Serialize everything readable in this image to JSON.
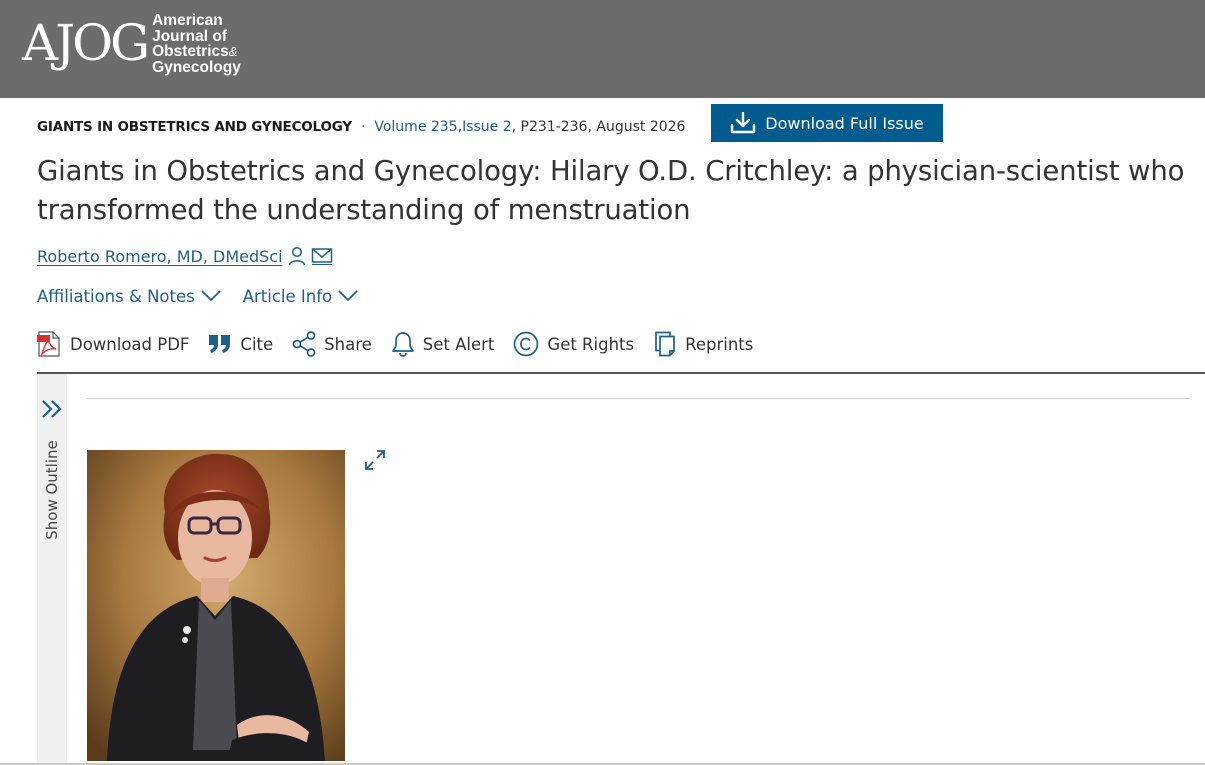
{
  "header": {
    "logo_mark": "AJOG",
    "logo_line1": "American",
    "logo_line2": "Journal of",
    "logo_line3": "Obstetrics",
    "logo_amp": "&",
    "logo_line4": "Gynecology"
  },
  "meta": {
    "section": "GIANTS IN OBSTETRICS AND GYNECOLOGY",
    "separator": "·",
    "volume": "Volume 235",
    "comma1": ", ",
    "issue": "Issue 2",
    "pages_date": ", P231-236, August 2026"
  },
  "download_issue_label": "Download Full Issue",
  "article": {
    "title": "Giants in Obstetrics and Gynecology: Hilary O.D. Critchley: a physician-scientist who transformed the understanding of menstruation",
    "author": "Roberto Romero, MD, DMedSci"
  },
  "info_links": {
    "affiliations": "Affiliations & Notes",
    "article_info": "Article Info"
  },
  "tools": {
    "download_pdf": "Download PDF",
    "cite": "Cite",
    "share": "Share",
    "set_alert": "Set Alert",
    "get_rights": "Get Rights",
    "reprints": "Reprints"
  },
  "outline": {
    "label": "Show Outline"
  },
  "colors": {
    "header_bg": "#6c6c6c",
    "link": "#1f5f8b",
    "button_bg": "#005b8e"
  }
}
